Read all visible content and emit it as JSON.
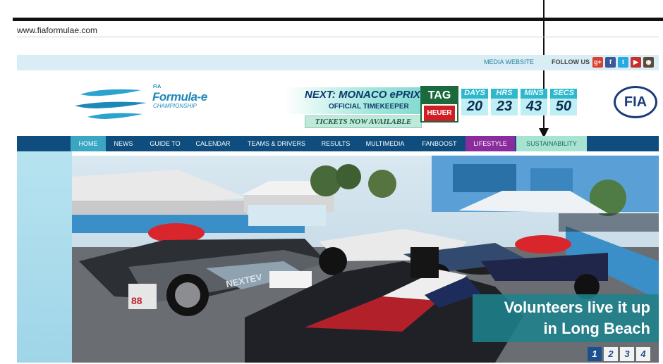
{
  "browser": {
    "url": "www.fiaformulae.com"
  },
  "utility": {
    "media_link": "MEDIA WEBSITE",
    "follow_label": "FOLLOW US",
    "social_icons": [
      "google-plus-icon",
      "facebook-icon",
      "twitter-icon",
      "youtube-icon",
      "instagram-icon"
    ]
  },
  "logo": {
    "fia": "FIA",
    "name": "Formula-e",
    "sub": "CHAMPIONSHIP"
  },
  "promo": {
    "next_race": "NEXT: MONACO ePRIX",
    "timekeeper": "OFFICIAL TIMEKEEPER",
    "tickets": "TICKETS NOW AVAILABLE",
    "sponsor_top": "TAG",
    "sponsor_bottom": "HEUER"
  },
  "countdown": {
    "labels": [
      "DAYS",
      "HRS",
      "MINS",
      "SECS"
    ],
    "values": [
      "20",
      "23",
      "43",
      "50"
    ]
  },
  "fia_logo": "FIA",
  "nav": {
    "items": [
      "HOME",
      "NEWS",
      "GUIDE TO",
      "CALENDAR",
      "TEAMS & DRIVERS",
      "RESULTS",
      "MULTIMEDIA",
      "FANBOOST",
      "LIFESTYLE",
      "SUSTAINABILITY"
    ],
    "active": "HOME"
  },
  "hero": {
    "caption_line1": "Volunteers live it up",
    "caption_line2": "in Long Beach",
    "car_number": "88",
    "car_livery": "NEXTEV",
    "pages": [
      "1",
      "2",
      "3",
      "4"
    ],
    "current_page": "1"
  },
  "colors": {
    "nav_bg": "#0e4d7d",
    "home_active": "#3aa6c4",
    "lifestyle": "#8a2c9e",
    "sustainability": "#a6e3d0",
    "countdown": "#2fb8cc",
    "caption_bg": "#1c828c"
  }
}
